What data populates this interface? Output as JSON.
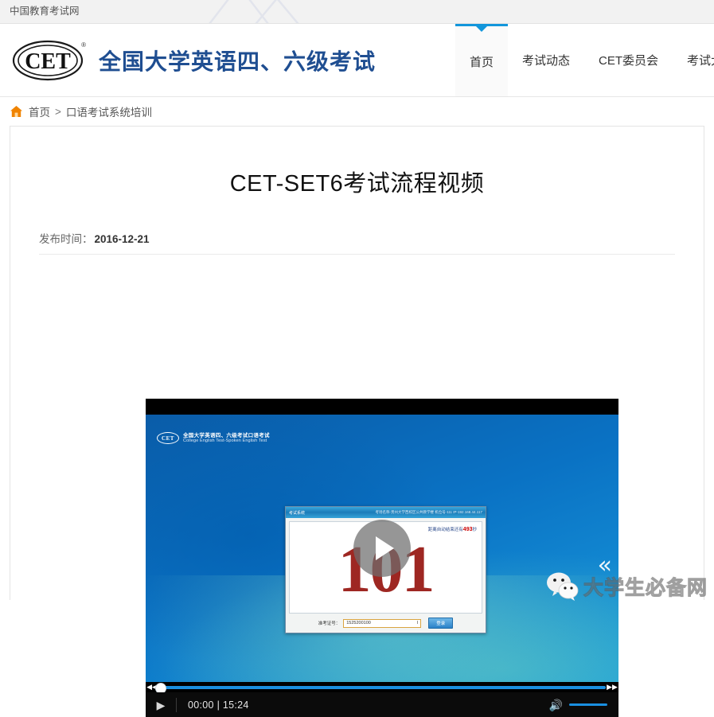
{
  "topbar": {
    "site_name": "中国教育考试网"
  },
  "header": {
    "logo_text": "CET",
    "logo_reg": "®",
    "logo_title": "全国大学英语四、六级考试",
    "nav": [
      {
        "label": "首页",
        "active": true
      },
      {
        "label": "考试动态",
        "active": false
      },
      {
        "label": "CET委员会",
        "active": false
      },
      {
        "label": "考试大",
        "active": false
      }
    ]
  },
  "breadcrumb": {
    "home_icon": "home-icon",
    "home_label": "首页",
    "separator": ">",
    "current": "口语考试系统培训"
  },
  "article": {
    "title": "CET-SET6考试流程视频",
    "publish_label": "发布时间：",
    "publish_date": "2016-12-21"
  },
  "video": {
    "overlay_play_icon": "play-icon",
    "side_chevron_icon": "chevron-double-left-icon",
    "brand": {
      "mark": "CET",
      "cn_title": "全国大学英语四、六级考试口语考试",
      "en_title": "College English Test-Spoken English Test"
    },
    "dialog": {
      "titlebar_left": "考试系统",
      "titlebar_right": "考场名称-贵州大学西校区公共教学楼   机位号-111 IP-192.168.44.117",
      "countdown_prefix": "距离自动结束还有",
      "countdown_value": "493",
      "countdown_suffix": "秒",
      "big_number": "101",
      "field_label": "准考证号：",
      "field_value": "1525200100",
      "submit_label": "登录"
    },
    "controls": {
      "prev_icon": "rewind-icon",
      "next_icon": "fast-forward-icon",
      "play_icon": "play-icon",
      "current_time": "00:00",
      "time_separator": "|",
      "duration": "15:24",
      "volume_icon": "volume-icon",
      "progress_percent": 0,
      "volume_percent": 100
    }
  },
  "watermark": {
    "wechat_icon": "wechat-icon",
    "text": "大学生必备网"
  },
  "colors": {
    "accent_blue": "#1296db",
    "brand_navy": "#1f4e91",
    "home_orange": "#f08300",
    "dialog_red": "#9e2722"
  }
}
